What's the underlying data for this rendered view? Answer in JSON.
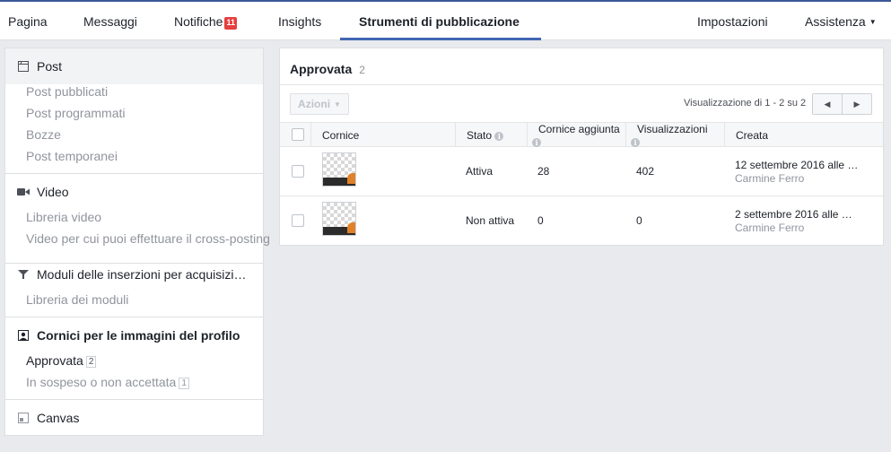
{
  "nav": {
    "pagina": "Pagina",
    "messaggi": "Messaggi",
    "notifiche": "Notifiche",
    "notifiche_count": "11",
    "insights": "Insights",
    "strumenti": "Strumenti di pubblicazione",
    "impostazioni": "Impostazioni",
    "assistenza": "Assistenza"
  },
  "sidebar": {
    "post": {
      "title": "Post",
      "items": [
        "Post pubblicati",
        "Post programmati",
        "Bozze",
        "Post temporanei"
      ]
    },
    "video": {
      "title": "Video",
      "items": [
        "Libreria video",
        "Video per cui puoi effettuare il cross-posting"
      ]
    },
    "moduli": {
      "title": "Moduli delle inserzioni per acquisizi…",
      "items": [
        "Libreria dei moduli"
      ]
    },
    "cornici": {
      "title": "Cornici per le immagini del profilo",
      "approvata": "Approvata",
      "approvata_count": "2",
      "sospeso": "In sospeso o non accettata",
      "sospeso_count": "1"
    },
    "canvas": {
      "title": "Canvas"
    }
  },
  "main": {
    "title": "Approvata",
    "count": "2",
    "actions_label": "Azioni",
    "pager_text": "Visualizzazione di 1 - 2 su 2",
    "columns": {
      "cornice": "Cornice",
      "stato": "Stato",
      "cornice_aggiunta": "Cornice aggiunta",
      "visualizzazioni": "Visualizzazioni",
      "creata": "Creata"
    },
    "rows": [
      {
        "stato": "Attiva",
        "aggiunta": "28",
        "visualizzazioni": "402",
        "creata": "12 settembre 2016 alle …",
        "autore": "Carmine Ferro"
      },
      {
        "stato": "Non attiva",
        "aggiunta": "0",
        "visualizzazioni": "0",
        "creata": "2 settembre 2016 alle …",
        "autore": "Carmine Ferro"
      }
    ]
  },
  "colors": {
    "brand": "#4267b2",
    "badge": "#e63f3f",
    "page_bg": "#e9eaed"
  }
}
